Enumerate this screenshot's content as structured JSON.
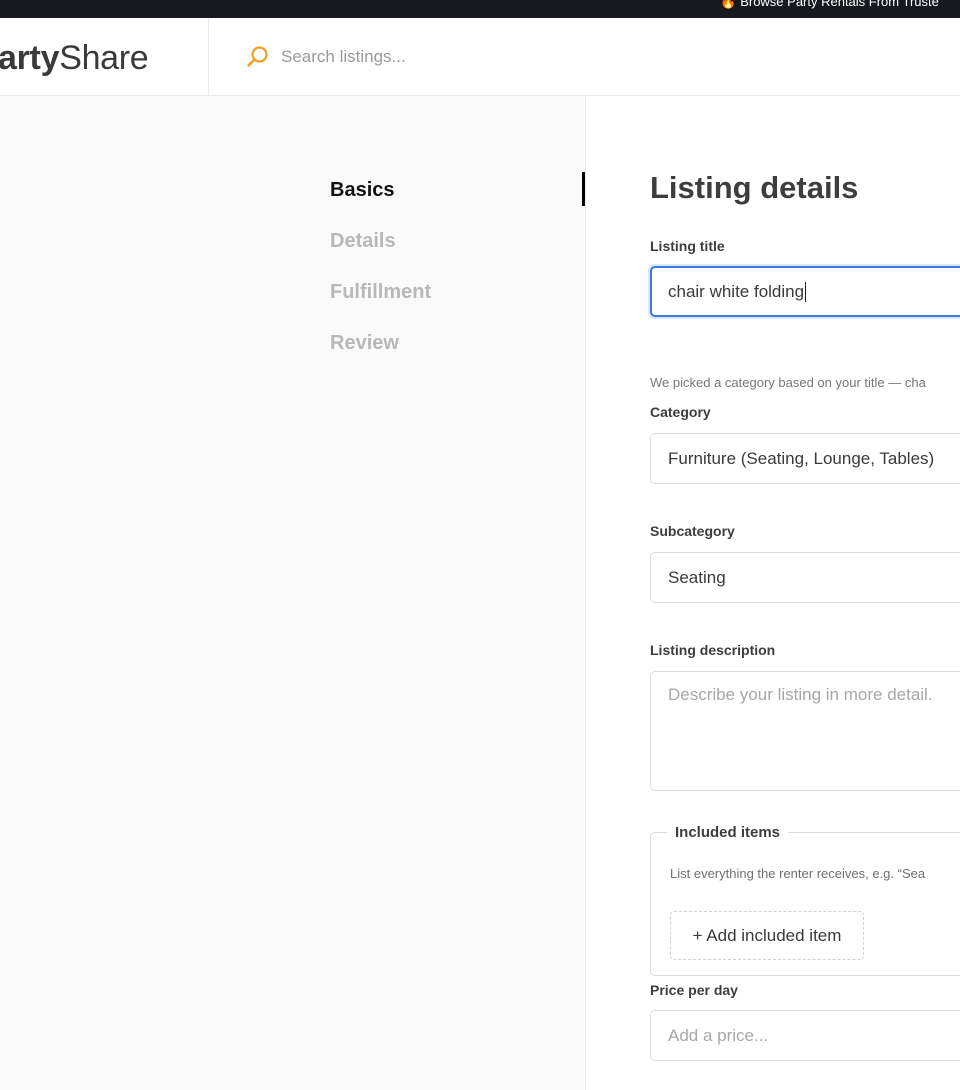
{
  "announcement": {
    "icon": "fire-icon",
    "text": "Browse Party Rentals From Truste"
  },
  "header": {
    "logo_bold": "arty",
    "logo_light": "Share",
    "search_placeholder": "Search listings..."
  },
  "steps": [
    {
      "label": "Basics",
      "active": true
    },
    {
      "label": "Details",
      "active": false
    },
    {
      "label": "Fulfillment",
      "active": false
    },
    {
      "label": "Review",
      "active": false
    }
  ],
  "form": {
    "title": "Listing details",
    "listing_title": {
      "label": "Listing title",
      "value": "chair white folding"
    },
    "category_hint": "We picked a category based on your title — cha",
    "category": {
      "label": "Category",
      "value": "Furniture (Seating, Lounge, Tables)"
    },
    "subcategory": {
      "label": "Subcategory",
      "value": "Seating"
    },
    "description": {
      "label": "Listing description",
      "placeholder": "Describe your listing in more detail."
    },
    "included_items": {
      "legend": "Included items",
      "hint": "List everything the renter receives, e.g. “Sea",
      "add_button": "+ Add included item"
    },
    "price": {
      "label": "Price per day",
      "placeholder": "Add a price..."
    }
  },
  "colors": {
    "accent_search": "#f0a020",
    "focus_ring": "#3a78e0",
    "announcement_bg": "#17191f"
  }
}
